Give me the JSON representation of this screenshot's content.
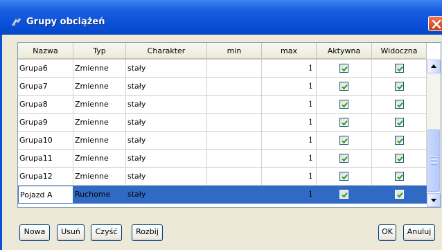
{
  "window": {
    "title": "Grupy obciążeń",
    "close_symbol": "✕"
  },
  "table": {
    "columns": [
      "Nazwa",
      "Typ",
      "Charakter",
      "min",
      "max",
      "Aktywna",
      "Widoczna"
    ],
    "rows": [
      {
        "name": "Grupa6",
        "typ": "Zmienne",
        "charakter": "stały",
        "min": "",
        "max": "1",
        "aktywna": true,
        "widoczna": true
      },
      {
        "name": "Grupa7",
        "typ": "Zmienne",
        "charakter": "stały",
        "min": "",
        "max": "1",
        "aktywna": true,
        "widoczna": true
      },
      {
        "name": "Grupa8",
        "typ": "Zmienne",
        "charakter": "stały",
        "min": "",
        "max": "1",
        "aktywna": true,
        "widoczna": true
      },
      {
        "name": "Grupa9",
        "typ": "Zmienne",
        "charakter": "stały",
        "min": "",
        "max": "1",
        "aktywna": true,
        "widoczna": true
      },
      {
        "name": "Grupa10",
        "typ": "Zmienne",
        "charakter": "stały",
        "min": "",
        "max": "1",
        "aktywna": true,
        "widoczna": true
      },
      {
        "name": "Grupa11",
        "typ": "Zmienne",
        "charakter": "stały",
        "min": "",
        "max": "1",
        "aktywna": true,
        "widoczna": true
      },
      {
        "name": "Grupa12",
        "typ": "Zmienne",
        "charakter": "stały",
        "min": "",
        "max": "1",
        "aktywna": true,
        "widoczna": true
      },
      {
        "name": "Pojazd A",
        "typ": "Ruchome",
        "charakter": "stały",
        "min": "",
        "max": "1",
        "aktywna": true,
        "widoczna": true,
        "selected": true
      }
    ]
  },
  "buttons": {
    "nowa": "Nowa",
    "usun": "Usuń",
    "czysc": "Czyść",
    "rozbij": "Rozbij",
    "ok": "OK",
    "anuluj": "Anuluj"
  },
  "icons": {
    "title_icon": "dialog-icon",
    "checkbox": "checkmark-icon"
  },
  "colors": {
    "titlebar": "#0a50d8",
    "selection": "#316ac5",
    "check": "#21a121",
    "close": "#c6401a"
  }
}
